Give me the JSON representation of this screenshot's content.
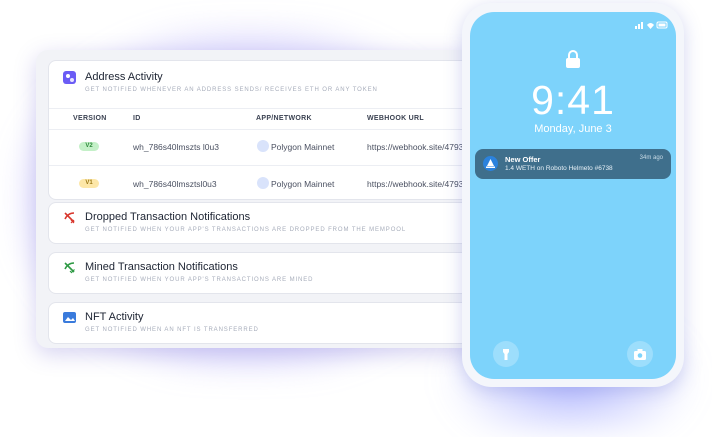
{
  "address_activity": {
    "title": "Address Activity",
    "subtitle": "Get notified whenever an address sends/ receives ETH or any token",
    "columns": [
      "VERSION",
      "ID",
      "APP/NETWORK",
      "WEBHOOK URL"
    ],
    "rows": [
      {
        "version": "V2",
        "id": "wh_786s40lmszts l0u3",
        "network": "Polygon Mainnet",
        "url": "https://webhook.site/4793..."
      },
      {
        "version": "V1",
        "id": "wh_786s40lmsztsl0u3",
        "network": "Polygon Mainnet",
        "url": "https://webhook.site/4793..."
      }
    ]
  },
  "dropped": {
    "title": "Dropped Transaction Notifications",
    "subtitle": "Get notified when your app's transactions are dropped from the mempool"
  },
  "mined": {
    "title": "Mined Transaction Notifications",
    "subtitle": "Get notified when your app's transactions are mined"
  },
  "nft": {
    "title": "NFT Activity",
    "subtitle": "Get notified when an NFT is transferred"
  },
  "phone": {
    "time": "9:41",
    "date": "Monday, June 3",
    "notification": {
      "title": "New Offer",
      "body": "1.4 WETH on Roboto Helmeto #6738",
      "time": "34m ago"
    }
  },
  "colors": {
    "v2_badge": "#c4f0c8",
    "v1_badge": "#fde7a8",
    "screen": "#7dd3fb",
    "accent": "#6b5cf5"
  }
}
